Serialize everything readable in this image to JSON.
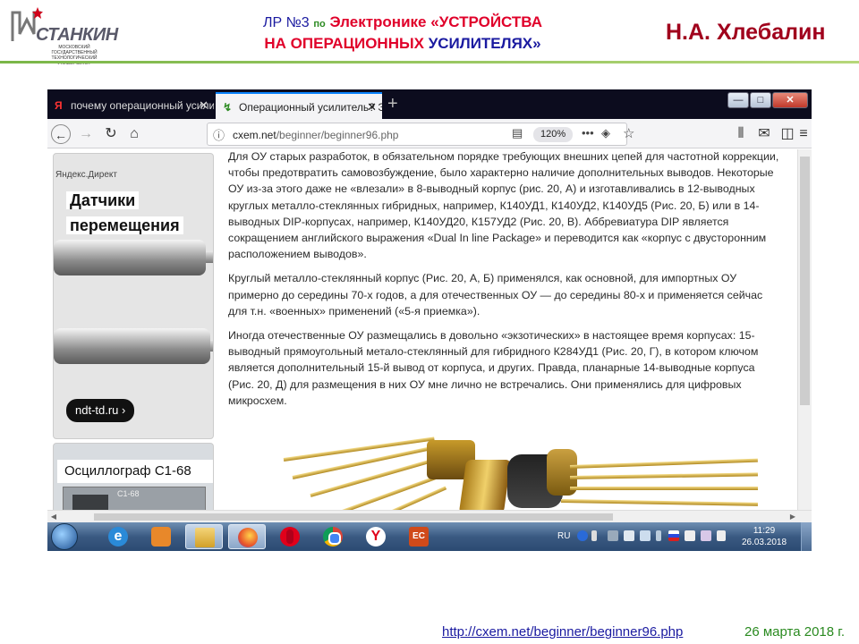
{
  "slide": {
    "logo": {
      "name": "СТАНКИН",
      "subtitle": "МОСКОВСКИЙ ГОСУДАРСТВЕННЫЙ ТЕХНОЛОГИЧЕСКИЙ УНИВЕРСИТЕТ"
    },
    "title": {
      "lr": "ЛР №3",
      "po": "по",
      "subject": "Электронике",
      "topic_red": "«УСТРОЙСТВА",
      "line2_red": "НА ОПЕРАЦИОННЫХ",
      "line2_blue": "УСИЛИТЕЛЯХ»"
    },
    "author": "Н.А. Хлебалин",
    "footer": {
      "link": "http://cxem.net/beginner/beginner96.php",
      "date": "26 марта 2018 г."
    }
  },
  "browser": {
    "tabs": [
      {
        "icon": "Я",
        "label": "почему операционный усилит",
        "close": "✕"
      },
      {
        "icon": "↯",
        "label": "Операционный усилитель? Э",
        "close": "✕"
      }
    ],
    "new_tab": "+",
    "url": {
      "host": "cxem.net",
      "path": "/beginner/beginner96.php"
    },
    "zoom": "120%"
  },
  "ads": {
    "label": "Яндекс.Директ",
    "ad1_title_line1": "Датчики",
    "ad1_title_line2": "перемещения",
    "ad1_button": "ndt-td.ru ›",
    "ad2_title": "Осциллограф С1-68",
    "ad2_device_label": "С1-68"
  },
  "article": {
    "paragraphs": [
      "Для ОУ старых разработок, в обязательном порядке требующих внешних цепей для частотной коррекции, чтобы предотвратить самовозбуждение, было характерно наличие дополнительных выводов. Некоторые ОУ из-за этого даже не «влезали» в 8-выводный корпус (рис. 20, А) и изготавливались в 12-выводных круглых металло-стеклянных гибридных, например, К140УД1, К140УД2, К140УД5 (Рис. 20, Б) или в 14-выводных DIP-корпусах, например, К140УД20, К157УД2 (Рис. 20, В). Аббревиатура DIP является сокращением английского выражения «Dual In line Package» и переводится как «корпус с двусторонним расположением выводов».",
      "Круглый металло-стеклянный корпус (Рис. 20, А, Б) применялся, как основной, для импортных ОУ примерно до середины 70-х годов, а для отечественных ОУ — до середины 80-х и применяется сейчас для т.н. «военных» применений («5-я приемка»).",
      "Иногда отечественные ОУ размещались в довольно «экзотических» в настоящее время корпусах: 15-выводный прямоугольный метало-стеклянный для гибридного К284УД1 (Рис. 20, Г), в котором ключом является дополнительный 15-й вывод от корпуса, и других. Правда, планарные 14-выводные корпуса (Рис. 20, Д) для размещения в них ОУ мне лично не встречались. Они применялись для цифровых микросхем."
    ]
  },
  "taskbar": {
    "lang": "RU",
    "time": "11:29",
    "date": "26.03.2018",
    "yandex_glyph": "Y",
    "ie_glyph": "e",
    "pres_glyph": "EC"
  },
  "colors": {
    "accent_red": "#e0002a",
    "accent_blue": "#1a1aa0",
    "author": "#a0001c",
    "rule_green": "#7ab648"
  }
}
